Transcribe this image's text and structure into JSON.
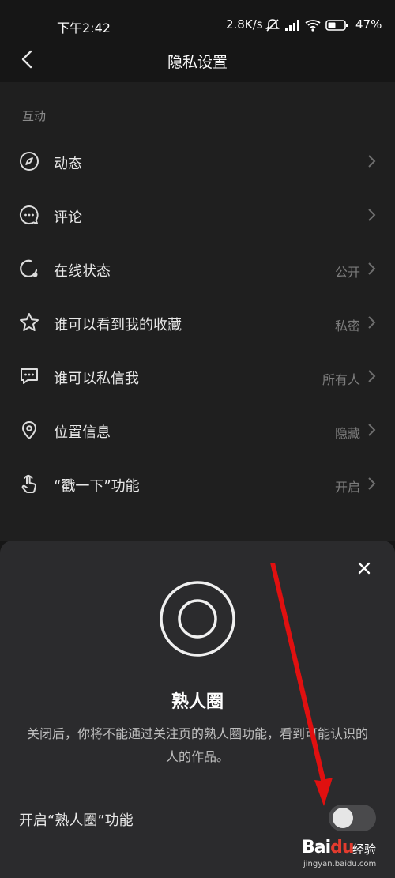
{
  "status_bar": {
    "time": "下午2:42",
    "net_speed": "2.8K/s",
    "battery": "47%"
  },
  "nav": {
    "title": "隐私设置"
  },
  "section": {
    "label": "互动"
  },
  "rows": [
    {
      "label": "动态",
      "value": "",
      "icon": "compass-icon"
    },
    {
      "label": "评论",
      "value": "",
      "icon": "comment-icon"
    },
    {
      "label": "在线状态",
      "value": "公开",
      "icon": "online-status-icon"
    },
    {
      "label": "谁可以看到我的收藏",
      "value": "私密",
      "icon": "star-icon"
    },
    {
      "label": "谁可以私信我",
      "value": "所有人",
      "icon": "message-icon"
    },
    {
      "label": "位置信息",
      "value": "隐藏",
      "icon": "location-icon"
    },
    {
      "label": "“戳一下”功能",
      "value": "开启",
      "icon": "poke-hand-icon"
    }
  ],
  "sheet": {
    "heading": "熟人圈",
    "description": "关闭后，你将不能通过关注页的熟人圈功能，看到可能认识的人的作品。",
    "toggle_label": "开启“熟人圈”功能",
    "toggle_on": false
  },
  "watermark": {
    "brand_a": "Bai",
    "brand_b": "du",
    "suffix": "经验",
    "url": "jingyan.baidu.com"
  },
  "colors": {
    "background": "#161616",
    "panel": "#1f1f1f",
    "sheet": "#2b2b2d",
    "arrow": "#e01010"
  }
}
